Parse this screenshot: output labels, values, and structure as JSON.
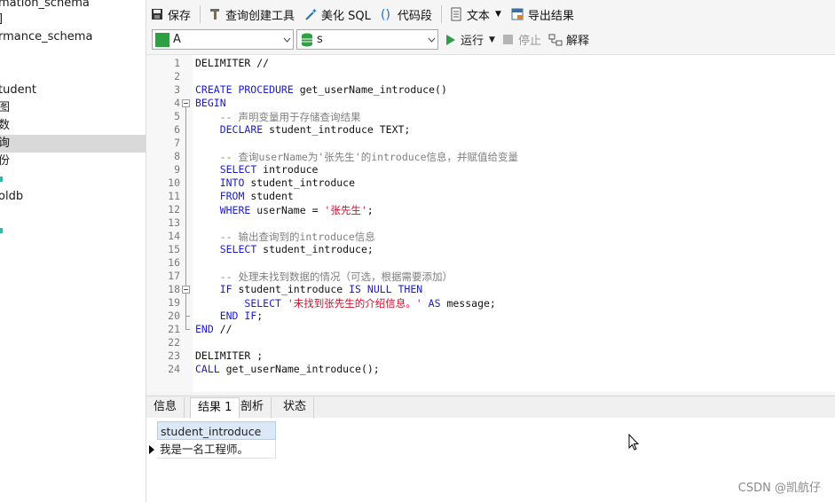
{
  "sidebar": {
    "items": [
      {
        "label": "mation_schema"
      },
      {
        "label": "]"
      },
      {
        "label": "rmance_schema"
      },
      {
        "label": "tudent"
      },
      {
        "label": "图"
      },
      {
        "label": "数"
      },
      {
        "label": "询"
      },
      {
        "label": "份"
      },
      {
        "label": "oldb"
      }
    ]
  },
  "toolbar": {
    "save": "保存",
    "query_builder": "查询创建工具",
    "beautify": "美化 SQL",
    "snippet": "代码段",
    "text": "文本",
    "export": "导出结果"
  },
  "toolbar2": {
    "connection": "A",
    "database": "s",
    "run": "运行",
    "stop": "停止",
    "explain": "解释"
  },
  "editor": {
    "lines": [
      {
        "n": "1",
        "parts": [
          {
            "t": "DELIMITER //",
            "c": ""
          }
        ]
      },
      {
        "n": "2",
        "parts": []
      },
      {
        "n": "3",
        "parts": [
          {
            "t": "CREATE PROCEDURE",
            "c": "kw"
          },
          {
            "t": " get_userName_introduce()",
            "c": ""
          }
        ]
      },
      {
        "n": "4",
        "parts": [
          {
            "t": "BEGIN",
            "c": "kw"
          }
        ]
      },
      {
        "n": "5",
        "parts": [
          {
            "t": "    -- 声明变量用于存储查询结果",
            "c": "cm"
          }
        ]
      },
      {
        "n": "6",
        "parts": [
          {
            "t": "    ",
            "c": ""
          },
          {
            "t": "DECLARE",
            "c": "kw"
          },
          {
            "t": " student_introduce TEXT;",
            "c": ""
          }
        ]
      },
      {
        "n": "7",
        "parts": []
      },
      {
        "n": "8",
        "parts": [
          {
            "t": "    -- 查询userName为'张先生'的introduce信息，并赋值给变量",
            "c": "cm"
          }
        ]
      },
      {
        "n": "9",
        "parts": [
          {
            "t": "    ",
            "c": ""
          },
          {
            "t": "SELECT",
            "c": "kw"
          },
          {
            "t": " introduce",
            "c": ""
          }
        ]
      },
      {
        "n": "10",
        "parts": [
          {
            "t": "    ",
            "c": ""
          },
          {
            "t": "INTO",
            "c": "kw"
          },
          {
            "t": " student_introduce",
            "c": ""
          }
        ]
      },
      {
        "n": "11",
        "parts": [
          {
            "t": "    ",
            "c": ""
          },
          {
            "t": "FROM",
            "c": "kw"
          },
          {
            "t": " student",
            "c": ""
          }
        ]
      },
      {
        "n": "12",
        "parts": [
          {
            "t": "    ",
            "c": ""
          },
          {
            "t": "WHERE",
            "c": "kw"
          },
          {
            "t": " userName = ",
            "c": ""
          },
          {
            "t": "'张先生'",
            "c": "st"
          },
          {
            "t": ";",
            "c": ""
          }
        ]
      },
      {
        "n": "13",
        "parts": []
      },
      {
        "n": "14",
        "parts": [
          {
            "t": "    -- 输出查询到的introduce信息",
            "c": "cm"
          }
        ]
      },
      {
        "n": "15",
        "parts": [
          {
            "t": "    ",
            "c": ""
          },
          {
            "t": "SELECT",
            "c": "kw"
          },
          {
            "t": " student_introduce;",
            "c": ""
          }
        ]
      },
      {
        "n": "16",
        "parts": []
      },
      {
        "n": "17",
        "parts": [
          {
            "t": "    -- 处理未找到数据的情况（可选，根据需要添加）",
            "c": "cm"
          }
        ]
      },
      {
        "n": "18",
        "parts": [
          {
            "t": "    ",
            "c": ""
          },
          {
            "t": "IF",
            "c": "kw"
          },
          {
            "t": " student_introduce ",
            "c": ""
          },
          {
            "t": "IS NULL THEN",
            "c": "kw"
          }
        ]
      },
      {
        "n": "19",
        "parts": [
          {
            "t": "        ",
            "c": ""
          },
          {
            "t": "SELECT",
            "c": "kw"
          },
          {
            "t": " ",
            "c": ""
          },
          {
            "t": "'未找到张先生的介绍信息。'",
            "c": "st"
          },
          {
            "t": " ",
            "c": ""
          },
          {
            "t": "AS",
            "c": "kw"
          },
          {
            "t": " message;",
            "c": ""
          }
        ]
      },
      {
        "n": "20",
        "parts": [
          {
            "t": "    ",
            "c": ""
          },
          {
            "t": "END IF",
            "c": "kw"
          },
          {
            "t": ";",
            "c": ""
          }
        ]
      },
      {
        "n": "21",
        "parts": [
          {
            "t": "END",
            "c": "kw"
          },
          {
            "t": " //",
            "c": ""
          }
        ]
      },
      {
        "n": "22",
        "parts": []
      },
      {
        "n": "23",
        "parts": [
          {
            "t": "DELIMITER ;",
            "c": ""
          }
        ]
      },
      {
        "n": "24",
        "parts": [
          {
            "t": "CALL",
            "c": "kw"
          },
          {
            "t": " get_userName_introduce();",
            "c": ""
          }
        ]
      }
    ]
  },
  "result_tabs": [
    "信息",
    "结果 1",
    "剖析",
    "状态"
  ],
  "result": {
    "column": "student_introduce",
    "rows": [
      "我是一名工程师。"
    ]
  },
  "watermark": "CSDN @凯航仔",
  "colors": {
    "keyword": "#1a1ad6",
    "comment": "#7f7f7f",
    "string": "#d0102d",
    "run_green": "#2ea043"
  }
}
